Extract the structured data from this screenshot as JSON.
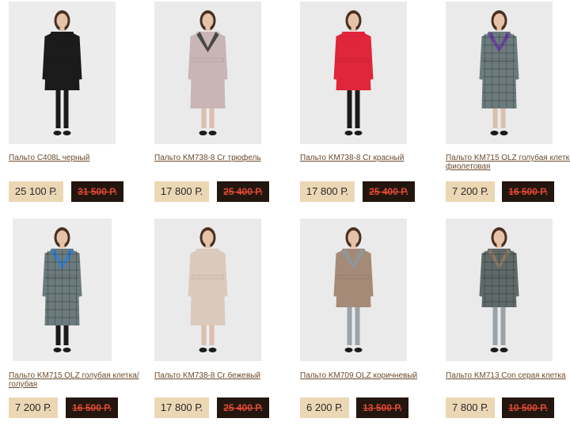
{
  "products": [
    {
      "name": "Пальто C408L черный",
      "price": "25 100 Р.",
      "old_price": "31 500 Р.",
      "coat": "#1b1b1b",
      "accent": "#1b1b1b",
      "legs": "#1b1b1b",
      "bg": "#ececec",
      "style": "short"
    },
    {
      "name": "Пальто KM738-8 Cr трюфель",
      "price": "17 800 Р.",
      "old_price": "25 400 Р.",
      "coat": "#c9b5b5",
      "accent": "#3b3b3b",
      "legs": "#d9bfae",
      "bg": "#eaeaea",
      "style": "long"
    },
    {
      "name": "Пальто KM738-8 Cr красный",
      "price": "17 800 Р.",
      "old_price": "25 400 Р.",
      "coat": "#e0263a",
      "accent": "#e0263a",
      "legs": "#1b1b1b",
      "bg": "#eaeaea",
      "style": "short"
    },
    {
      "name": "Пальто KM715 OLZ голубая клетка/ фиолетовая",
      "price": "7 200 Р.",
      "old_price": "16 500 Р.",
      "coat": "#6c7b7d",
      "accent": "#6a3aa6",
      "legs": "#d9bfae",
      "bg": "#eaeaea",
      "style": "long"
    },
    {
      "name": "Пальто KM715 OLZ голубая клетка/ голубая",
      "price": "7 200 Р.",
      "old_price": "16 500 Р.",
      "coat": "#6c7b7d",
      "accent": "#2f7fd8",
      "legs": "#1b1b1b",
      "bg": "#ececec",
      "style": "long"
    },
    {
      "name": "Пальто KM738-8 Cr бежевый",
      "price": "17 800 Р.",
      "old_price": "25 400 Р.",
      "coat": "#dcc9bd",
      "accent": "#dcc9bd",
      "legs": "#d9bfae",
      "bg": "#eaeaea",
      "style": "long"
    },
    {
      "name": "Пальто KM709 OLZ коричневый",
      "price": "6 200 Р.",
      "old_price": "13 500 Р.",
      "coat": "#a58a78",
      "accent": "#8a9aa0",
      "legs": "#9aa3aa",
      "bg": "#eaeaea",
      "style": "short"
    },
    {
      "name": "Пальто KM713 Con серая клетка",
      "price": "7 800 Р.",
      "old_price": "10 500 Р.",
      "coat": "#5f6a68",
      "accent": "#8f7a66",
      "legs": "#9aa3aa",
      "bg": "#eaeaea",
      "style": "short"
    }
  ]
}
